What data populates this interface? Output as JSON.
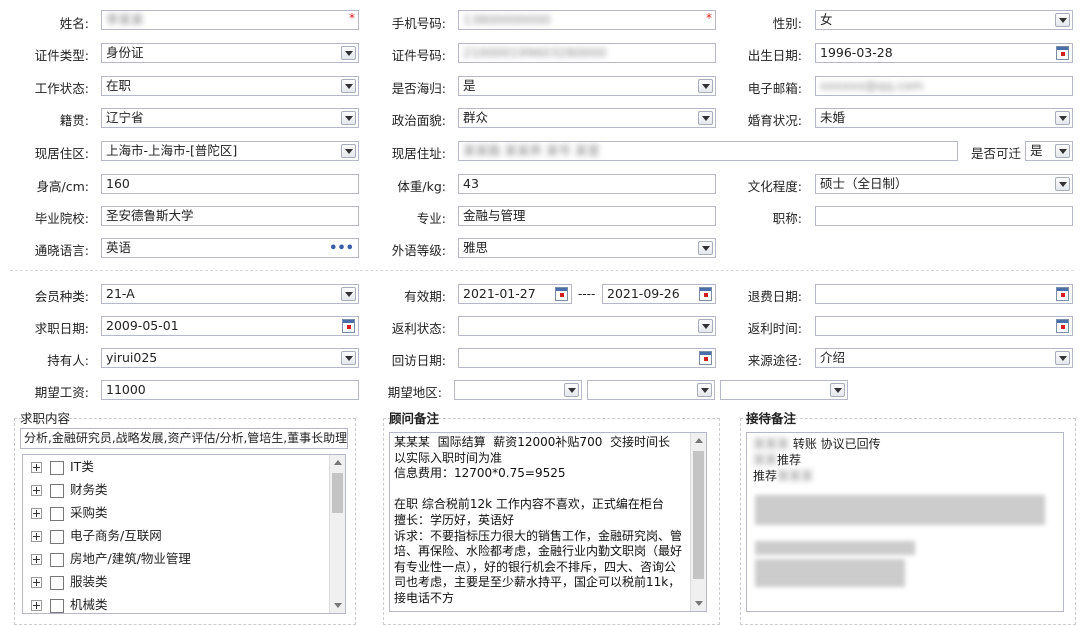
{
  "rows": {
    "r1": {
      "name_label": "姓名:",
      "name_value": "李某某",
      "phone_label": "手机号码:",
      "phone_value": "13800000000",
      "gender_label": "性别:",
      "gender_value": "女"
    },
    "r2": {
      "idtype_label": "证件类型:",
      "idtype_value": "身份证",
      "idno_label": "证件号码:",
      "idno_value": "210000199603280000",
      "birth_label": "出生日期:",
      "birth_value": "1996-03-28"
    },
    "r3": {
      "workstatus_label": "工作状态:",
      "workstatus_value": "在职",
      "overseas_label": "是否海归:",
      "overseas_value": "是",
      "email_label": "电子邮箱:",
      "email_value": "xxxxxx@qq.com"
    },
    "r4": {
      "native_label": "籍贯:",
      "native_value": "辽宁省",
      "political_label": "政治面貌:",
      "political_value": "群众",
      "marital_label": "婚育状况:",
      "marital_value": "未婚"
    },
    "r5": {
      "region_label": "现居住区:",
      "region_value": "上海市-上海市-[普陀区]",
      "address_label": "现居住址:",
      "address_value": "某某路 某某弄 某号 某室",
      "relocate_label": "是否可迁",
      "relocate_value": "是"
    },
    "r6": {
      "height_label": "身高/cm:",
      "height_value": "160",
      "weight_label": "体重/kg:",
      "weight_value": "43",
      "edu_label": "文化程度:",
      "edu_value": "硕士（全日制）"
    },
    "r7": {
      "school_label": "毕业院校:",
      "school_value": "圣安德鲁斯大学",
      "major_label": "专业:",
      "major_value": "金融与管理",
      "title_label": "职称:",
      "title_value": ""
    },
    "r8": {
      "lang_label": "通晓语言:",
      "lang_value": "英语",
      "langlevel_label": "外语等级:",
      "langlevel_value": "雅思"
    },
    "r9": {
      "member_label": "会员种类:",
      "member_value": "21-A",
      "valid_label": "有效期:",
      "valid_from": "2021-01-27",
      "valid_sep": "----",
      "valid_to": "2021-09-26",
      "refund_label": "退费日期:",
      "refund_value": ""
    },
    "r10": {
      "jobdate_label": "求职日期:",
      "jobdate_value": "2009-05-01",
      "rebate_label": "返利状态:",
      "rebate_value": "",
      "rebatetime_label": "返利时间:",
      "rebatetime_value": ""
    },
    "r11": {
      "holder_label": "持有人:",
      "holder_value": "yirui025",
      "visit_label": "回访日期:",
      "visit_value": "",
      "source_label": "来源途径:",
      "source_value": "介绍"
    },
    "r12": {
      "salary_label": "期望工资:",
      "salary_value": "11000",
      "area_label": "期望地区:"
    }
  },
  "job_panel": {
    "title": "求职内容",
    "summary": "分析,金融研究员,战略发展,资产评估/分析,管培生,董事长助理",
    "tree": [
      "IT类",
      "财务类",
      "采购类",
      "电子商务/互联网",
      "房地产/建筑/物业管理",
      "服装类",
      "机械类"
    ]
  },
  "consultant_panel": {
    "title": "顾问备注",
    "text": "某某某  国际结算  薪资12000补贴700  交接时间长 以实际入职时间为准\n信息费用：12700*0.75=9525\n\n在职 综合税前12k 工作内容不喜欢，正式编在柜台\n擅长：学历好，英语好\n诉求：不要指标压力很大的销售工作，金融研究岗、管培、再保险、水险都考虑，金融行业内勤文职岗（最好有专业性一点），好的银行机会不排斥，四大、咨询公司也考虑，主要是至少薪水持平，国企可以税前11k，接电话不方"
  },
  "reception_panel": {
    "title": "接待备注",
    "line1_suffix": "转账 协议已回传",
    "line2_suffix": "推荐",
    "line3_prefix": "推荐"
  }
}
